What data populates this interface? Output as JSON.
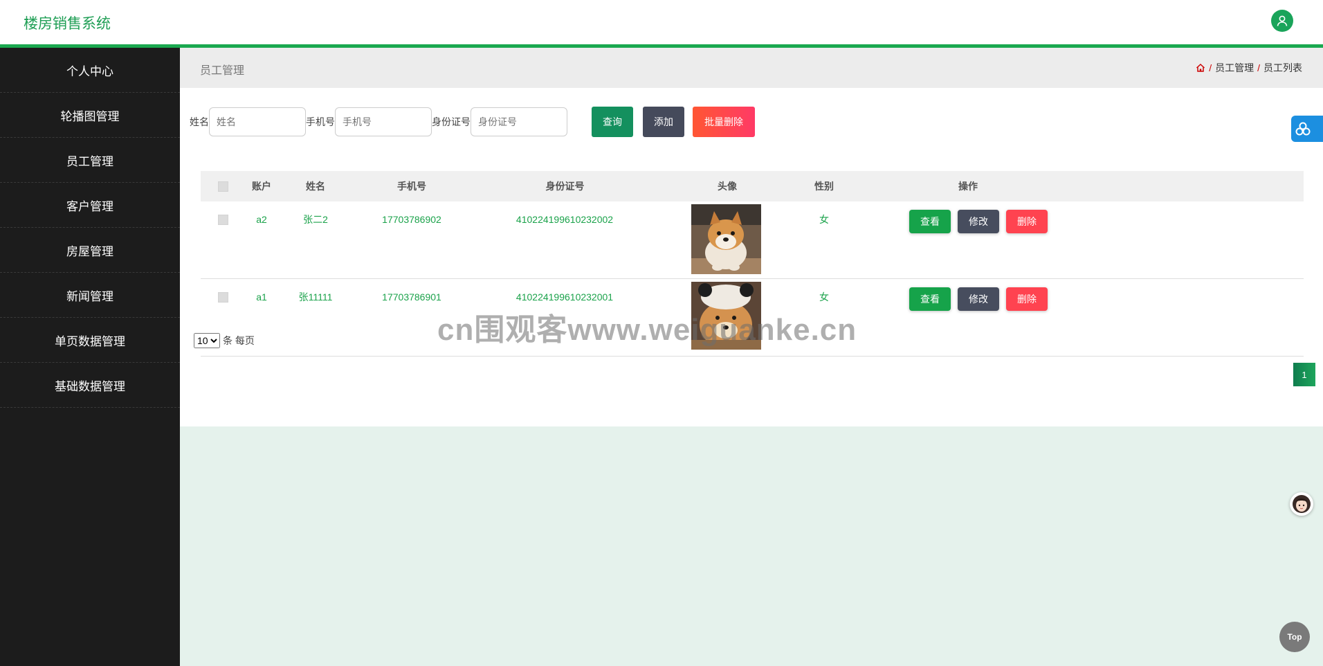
{
  "app": {
    "title": "楼房销售系统"
  },
  "sidebar": {
    "items": [
      {
        "label": "个人中心"
      },
      {
        "label": "轮播图管理"
      },
      {
        "label": "员工管理"
      },
      {
        "label": "客户管理"
      },
      {
        "label": "房屋管理"
      },
      {
        "label": "新闻管理"
      },
      {
        "label": "单页数据管理"
      },
      {
        "label": "基础数据管理"
      }
    ]
  },
  "breadcrumb": {
    "page_title": "员工管理",
    "items": [
      "员工管理",
      "员工列表"
    ],
    "separator": "/"
  },
  "search": {
    "name_label": "姓名",
    "name_placeholder": "姓名",
    "phone_label": "手机号",
    "phone_placeholder": "手机号",
    "id_label": "身份证号",
    "id_placeholder": "身份证号",
    "query_label": "查询",
    "add_label": "添加",
    "batch_delete_label": "批量删除"
  },
  "table": {
    "columns": [
      "账户",
      "姓名",
      "手机号",
      "身份证号",
      "头像",
      "性别",
      "操作"
    ],
    "rows": [
      {
        "account": "a2",
        "name": "张二2",
        "phone": "17703786902",
        "id_number": "410224199610232002",
        "avatar": "shiba-dog-photo",
        "gender": "女"
      },
      {
        "account": "a1",
        "name": "张11111",
        "phone": "17703786901",
        "id_number": "410224199610232001",
        "avatar": "shiba-dog-hat-photo",
        "gender": "女"
      }
    ],
    "actions": {
      "view": "查看",
      "edit": "修改",
      "delete": "删除"
    }
  },
  "pagination": {
    "page_size": "10",
    "page_size_options": [
      "10"
    ],
    "per_page_text": "条 每页",
    "current_page": "1"
  },
  "widgets": {
    "top_label": "Top"
  },
  "watermark": "cn围观客www.weiguanke.cn",
  "colors": {
    "brand": "#1aa84f",
    "sidebar_bg": "#1c1c1c",
    "danger": "#ff4350",
    "dark_button": "#454a5b"
  }
}
